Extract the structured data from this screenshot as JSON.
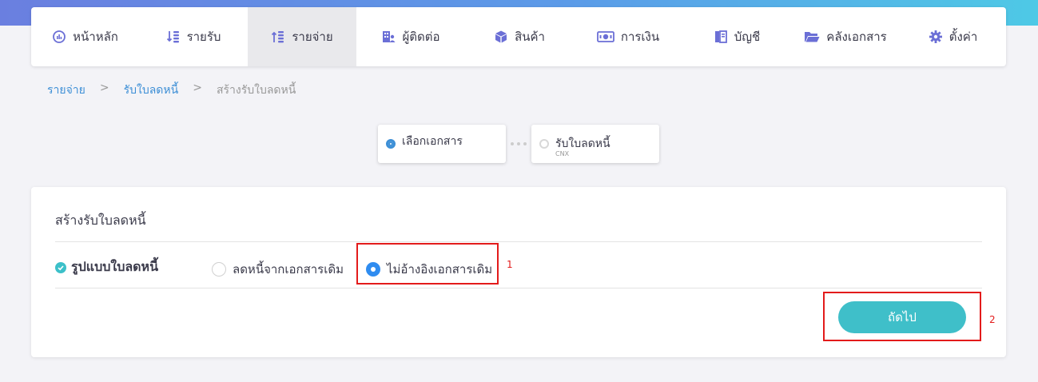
{
  "nav": {
    "items": [
      {
        "label": "หน้าหลัก",
        "icon": "dashboard-icon",
        "active": false
      },
      {
        "label": "รายรับ",
        "icon": "income-icon",
        "active": false
      },
      {
        "label": "รายจ่าย",
        "icon": "expense-icon",
        "active": true
      },
      {
        "label": "ผู้ติดต่อ",
        "icon": "contacts-icon",
        "active": false
      },
      {
        "label": "สินค้า",
        "icon": "product-box-icon",
        "active": false
      },
      {
        "label": "การเงิน",
        "icon": "money-icon",
        "active": false
      },
      {
        "label": "บัญชี",
        "icon": "ledger-icon",
        "active": false
      },
      {
        "label": "คลังเอกสาร",
        "icon": "folder-icon",
        "active": false
      },
      {
        "label": "ตั้งค่า",
        "icon": "gear-icon",
        "active": false
      }
    ]
  },
  "breadcrumb": {
    "items": [
      "รายจ่าย",
      "รับใบลดหนี้",
      "สร้างรับใบลดหนี้"
    ],
    "separator": ">"
  },
  "steps": [
    {
      "label": "เลือกเอกสาร",
      "sub": "",
      "active": true
    },
    {
      "label": "รับใบลดหนี้",
      "sub": "CNX",
      "active": false
    }
  ],
  "form": {
    "title": "สร้างรับใบลดหนี้",
    "field_label": "รูปแบบใบลดหนี้",
    "options": [
      {
        "label": "ลดหนี้จากเอกสารเดิม",
        "selected": false
      },
      {
        "label": "ไม่อ้างอิงเอกสารเดิม",
        "selected": true
      }
    ],
    "next_label": "ถัดไป"
  },
  "annotations": [
    "1",
    "2"
  ],
  "colors": {
    "accent": "#3fbfc9",
    "link": "#3d8fd6",
    "radio_selected": "#2f8cf0",
    "annotation": "#e31b1b",
    "nav_icon": "#6b6fd6"
  }
}
